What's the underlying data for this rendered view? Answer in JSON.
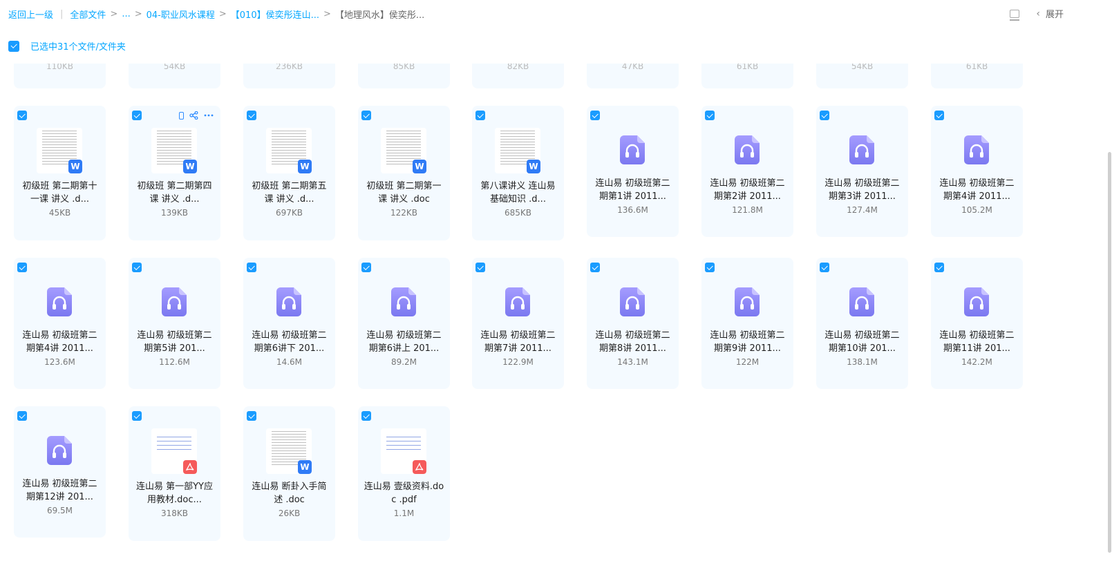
{
  "breadcrumb": {
    "back": "返回上一级",
    "items": [
      "全部文件",
      "...",
      "04-职业风水课程",
      "【010】侯奕彤连山...",
      "【地理风水】侯奕彤..."
    ]
  },
  "toolbar": {
    "expand_label": "展开"
  },
  "selection": {
    "label": "已选中31个文件/文件夹"
  },
  "top_partial_sizes": [
    "110KB",
    "54KB",
    "236KB",
    "85KB",
    "82KB",
    "47KB",
    "61KB",
    "54KB",
    "61KB"
  ],
  "files": [
    {
      "name": "初级班 第二期第十一课 讲义 .d...",
      "size": "45KB",
      "type": "word"
    },
    {
      "name": "初级班 第二期第四课 讲义 .d...",
      "size": "139KB",
      "type": "word"
    },
    {
      "name": "初级班 第二期第五课 讲义 .d...",
      "size": "697KB",
      "type": "word"
    },
    {
      "name": "初级班 第二期第一课 讲义 .doc",
      "size": "122KB",
      "type": "word"
    },
    {
      "name": "第八课讲义 连山易基础知识 .d...",
      "size": "685KB",
      "type": "word"
    },
    {
      "name": "连山易 初级班第二期第1讲 2011...",
      "size": "136.6M",
      "type": "audio"
    },
    {
      "name": "连山易 初级班第二期第2讲 2011...",
      "size": "121.8M",
      "type": "audio"
    },
    {
      "name": "连山易 初级班第二期第3讲 2011...",
      "size": "127.4M",
      "type": "audio"
    },
    {
      "name": "连山易 初级班第二期第4讲 2011...",
      "size": "105.2M",
      "type": "audio"
    },
    {
      "name": "连山易 初级班第二期第4讲 2011...",
      "size": "123.6M",
      "type": "audio"
    },
    {
      "name": "连山易 初级班第二期第5讲 201...",
      "size": "112.6M",
      "type": "audio"
    },
    {
      "name": "连山易 初级班第二期第6讲下 201...",
      "size": "14.6M",
      "type": "audio"
    },
    {
      "name": "连山易 初级班第二期第6讲上 201...",
      "size": "89.2M",
      "type": "audio"
    },
    {
      "name": "连山易 初级班第二期第7讲 2011...",
      "size": "122.9M",
      "type": "audio"
    },
    {
      "name": "连山易 初级班第二期第8讲 2011...",
      "size": "143.1M",
      "type": "audio"
    },
    {
      "name": "连山易 初级班第二期第9讲 2011...",
      "size": "122M",
      "type": "audio"
    },
    {
      "name": "连山易 初级班第二期第10讲 201...",
      "size": "138.1M",
      "type": "audio"
    },
    {
      "name": "连山易 初级班第二期第11讲 201...",
      "size": "142.2M",
      "type": "audio"
    },
    {
      "name": "连山易 初级班第二期第12讲 201...",
      "size": "69.5M",
      "type": "audio"
    },
    {
      "name": "连山易 第一部YY应用教材.doc...",
      "size": "318KB",
      "type": "pdf"
    },
    {
      "name": "连山易 断卦入手简述 .doc",
      "size": "26KB",
      "type": "word"
    },
    {
      "name": "连山易 壹级资料.doc .pdf",
      "size": "1.1M",
      "type": "pdf"
    }
  ],
  "icons": {
    "word_badge": "W",
    "checkbox": "check-icon",
    "audio": "headphones-icon"
  },
  "colors": {
    "accent": "#06a7ff",
    "audio_icon": "#8a86f7",
    "word_badge": "#2f7bf6",
    "pdf_badge": "#f55a5a",
    "card_bg": "#f4faff"
  }
}
